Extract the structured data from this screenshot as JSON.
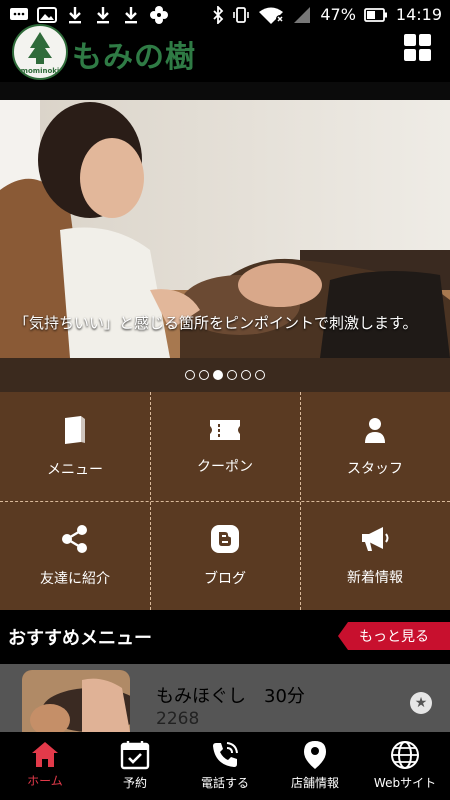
{
  "status_bar": {
    "battery_percent": "47%",
    "time": "14:19",
    "left_icons": [
      "message-icon",
      "image-icon",
      "download-icon",
      "download-icon",
      "download-icon",
      "pinwheel-icon"
    ],
    "right_icons": [
      "bluetooth-icon",
      "vibrate-icon",
      "wifi-icon",
      "signal-icon",
      "battery-icon"
    ]
  },
  "header": {
    "logo_text": "もみの樹",
    "logo_badge_text": "mominoki",
    "menu_icon": "grid-icon"
  },
  "hero": {
    "caption": "「気持ちいい」と感じる箇所をピンポイントで刺激します。",
    "slide_count": 6,
    "active_slide": 3
  },
  "tiles": [
    {
      "label": "メニュー",
      "icon": "book-icon"
    },
    {
      "label": "クーポン",
      "icon": "ticket-icon"
    },
    {
      "label": "スタッフ",
      "icon": "person-icon"
    },
    {
      "label": "友達に紹介",
      "icon": "share-icon"
    },
    {
      "label": "ブログ",
      "icon": "blogger-icon"
    },
    {
      "label": "新着情報",
      "icon": "megaphone-icon"
    }
  ],
  "recommend": {
    "title": "おすすめメニュー",
    "more_label": "もっと見る",
    "item_name": "もみほぐし　30分",
    "item_price": "2268"
  },
  "tabbar": [
    {
      "label": "ホーム",
      "icon": "home-icon",
      "active": true
    },
    {
      "label": "予約",
      "icon": "calendar-icon",
      "active": false
    },
    {
      "label": "電話する",
      "icon": "phone-icon",
      "active": false
    },
    {
      "label": "店舗情報",
      "icon": "map-pin-icon",
      "active": false
    },
    {
      "label": "Webサイト",
      "icon": "globe-icon",
      "active": false
    }
  ],
  "colors": {
    "tile_bg": "#5a3a22",
    "accent_red": "#c8102e",
    "logo_green": "#2f7b45"
  }
}
